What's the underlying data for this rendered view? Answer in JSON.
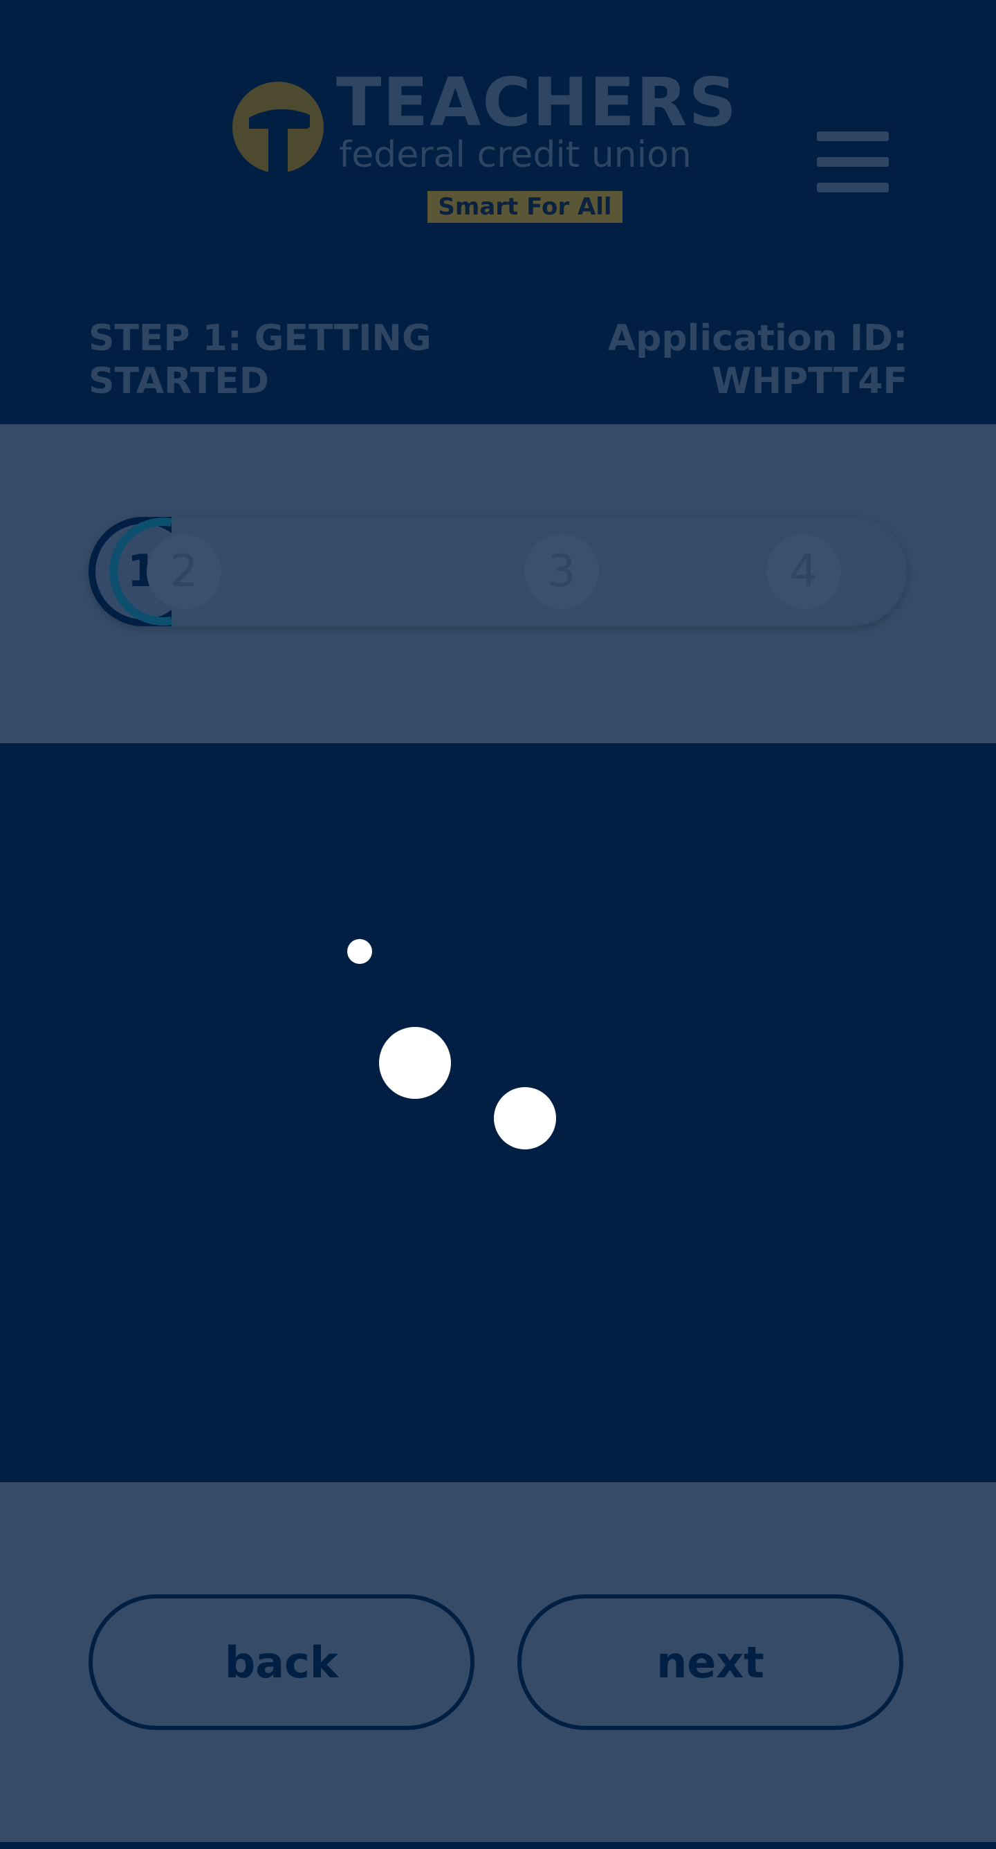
{
  "brand": {
    "name": "TEACHERS",
    "subtitle": "federal credit union",
    "tagline": "Smart For All",
    "logo_icon": "tfcu-logo-mark"
  },
  "header": {
    "menu_icon": "hamburger-menu-icon",
    "step_title": "STEP 1: GETTING STARTED",
    "application_id_label": "Application ID:",
    "application_id_value": "WHPTT4F"
  },
  "progress": {
    "steps": [
      "1",
      "2",
      "3",
      "4"
    ],
    "current_step": 1
  },
  "loading": {
    "indicator_icon": "loading-dots-icon"
  },
  "footer": {
    "back_label": "back",
    "next_label": "next"
  },
  "colors": {
    "header_bg": "#011e43",
    "overlay_bg": "#354b68",
    "logo_gold": "#5b5736",
    "text_dim": "#2e4563",
    "spinner": "#ffffff"
  }
}
